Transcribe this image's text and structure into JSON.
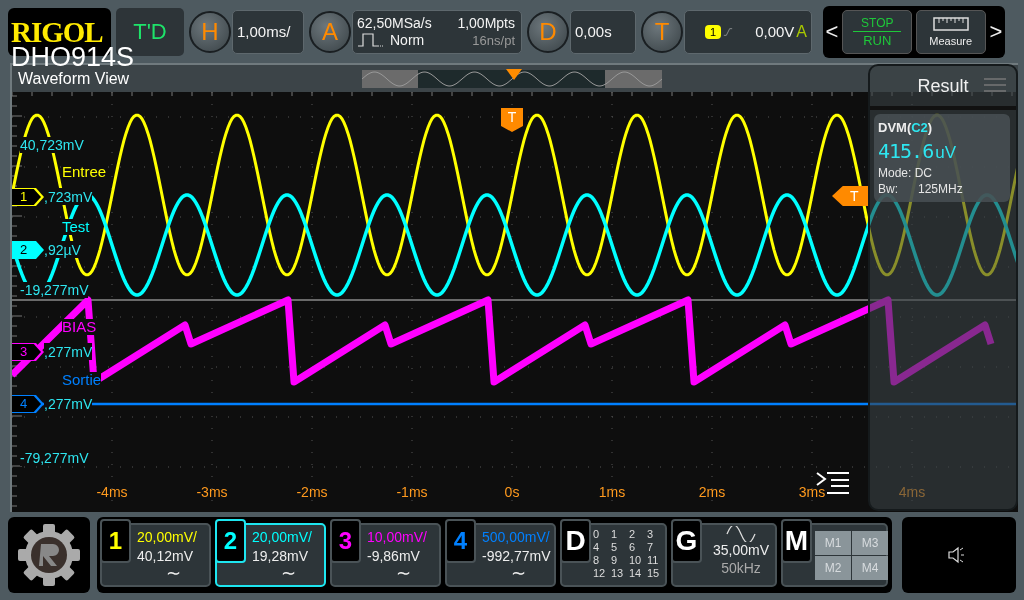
{
  "logo": {
    "brand": "RIGOL",
    "model": "DHO914S"
  },
  "top_bar": {
    "mode_button": "T'D",
    "horizontal": {
      "key": "H",
      "scale": "1,00ms/"
    },
    "acquire": {
      "key": "A",
      "sample_rate": "62,50MSa/s",
      "memory_depth": "1,00Mpts",
      "mode": "Norm",
      "resolution": "16ns/pt"
    },
    "delay": {
      "key": "D",
      "value": "0,00s"
    },
    "trigger": {
      "key": "T",
      "source": "1",
      "level": "0,00V",
      "sweep": "A"
    }
  },
  "controls": {
    "prev": "<",
    "run_stop": {
      "top": "STOP",
      "bottom": "RUN"
    },
    "measure": "Measure",
    "next": ">"
  },
  "waveform": {
    "title": "Waveform View",
    "trigger_position_marker": "T",
    "trigger_level_marker": "T",
    "scale_labels": [
      "40,723mV",
      "-19,277mV",
      "-79,277mV"
    ],
    "channels": [
      {
        "number": "1",
        "name": "Entree",
        "offset_label": ",723mV",
        "color": "#ffff00"
      },
      {
        "number": "2",
        "name": "Test",
        "offset_label": ",92µV",
        "color": "#00ffff"
      },
      {
        "number": "3",
        "name": "BIAS",
        "offset_label": ",277mV",
        "color": "#ff00ff"
      },
      {
        "number": "4",
        "name": "Sortie",
        "offset_label": ",277mV",
        "color": "#0080ff"
      }
    ],
    "x_axis": [
      "-4ms",
      "-3ms",
      "-2ms",
      "-1ms",
      "0s",
      "1ms",
      "2ms",
      "3ms",
      "4ms"
    ]
  },
  "result": {
    "title": "Result",
    "dvm": {
      "prefix": "DVM(",
      "source": "C2",
      "suffix": ")",
      "reading": "415.6",
      "unit": "uV",
      "mode": "Mode: DC",
      "bw_label": "Bw:",
      "bw_value": "125MHz"
    }
  },
  "channel_cards": [
    {
      "number": "1",
      "scale": "20,00mV/",
      "offset": "40,12mV",
      "coupling": "∼",
      "selected": false
    },
    {
      "number": "2",
      "scale": "20,00mV/",
      "offset": "19,28mV",
      "coupling": "∼",
      "selected": true
    },
    {
      "number": "3",
      "scale": "10,00mV/",
      "offset": "-9,86mV",
      "coupling": "∼",
      "selected": false
    },
    {
      "number": "4",
      "scale": "500,00mV/",
      "offset": "-992,77mV",
      "coupling": "∼",
      "selected": false
    }
  ],
  "digital": {
    "key": "D",
    "bits": [
      "0",
      "1",
      "2",
      "3",
      "4",
      "5",
      "6",
      "7",
      "8",
      "9",
      "10",
      "11",
      "12",
      "13",
      "14",
      "15"
    ]
  },
  "generator": {
    "key": "G",
    "amplitude": "35,00mV",
    "frequency": "50kHz"
  },
  "math": {
    "key": "M",
    "items": [
      "M1",
      "M3",
      "M2",
      "M4"
    ]
  }
}
